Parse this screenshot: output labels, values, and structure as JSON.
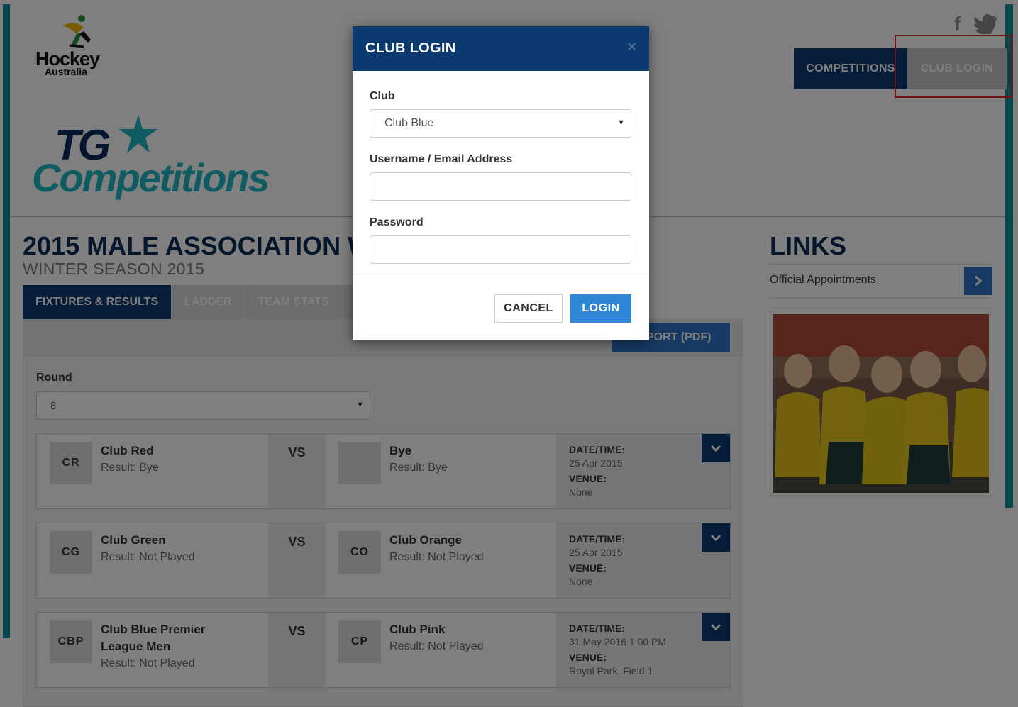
{
  "header": {
    "logo_line1": "Hockey",
    "logo_line2": "Australia",
    "tg_line1": "TG",
    "tg_line2": "Competitions",
    "social_facebook": "f",
    "nav": {
      "competitions": "COMPETITIONS",
      "club_login": "CLUB LOGIN"
    }
  },
  "main": {
    "title": "2015 MALE ASSOCIATION W",
    "subtitle": "WINTER SEASON 2015",
    "tabs": [
      "FIXTURES & RESULTS",
      "LADDER",
      "TEAM STATS"
    ],
    "export_label": "EXPORT (PDF)",
    "round_label": "Round",
    "round_value": "8",
    "vs_label": "VS",
    "date_label": "DATE/TIME:",
    "venue_label": "VENUE:",
    "matches": [
      {
        "home_badge": "CR",
        "home_name": "Club Red",
        "home_result": "Result: Bye",
        "away_badge": "",
        "away_name": "Bye",
        "away_result": "Result: Bye",
        "date": "25 Apr 2015",
        "venue": "None"
      },
      {
        "home_badge": "CG",
        "home_name": "Club Green",
        "home_result": "Result: Not Played",
        "away_badge": "CO",
        "away_name": "Club Orange",
        "away_result": "Result: Not Played",
        "date": "25 Apr 2015",
        "venue": "None"
      },
      {
        "home_badge": "CBP",
        "home_name_line1": "Club Blue Premier",
        "home_name_line2": "League Men",
        "home_result": "Result: Not Played",
        "away_badge": "CP",
        "away_name": "Club Pink",
        "away_result": "Result: Not Played",
        "date": "31 May 2016 1:00 PM",
        "venue": "Royal Park, Field 1"
      }
    ]
  },
  "sidebar": {
    "title": "LINKS",
    "items": [
      {
        "label": "Official Appointments"
      }
    ]
  },
  "modal": {
    "title": "CLUB LOGIN",
    "close": "×",
    "club_label": "Club",
    "club_value": "Club Blue",
    "username_label": "Username / Email Address",
    "username_value": "",
    "password_label": "Password",
    "password_value": "",
    "cancel_label": "CANCEL",
    "login_label": "LOGIN"
  },
  "colors": {
    "navy": "#0b3a70",
    "teal": "#0e8f98",
    "accent_blue": "#2e86d4",
    "highlight_red": "#e0252b"
  }
}
